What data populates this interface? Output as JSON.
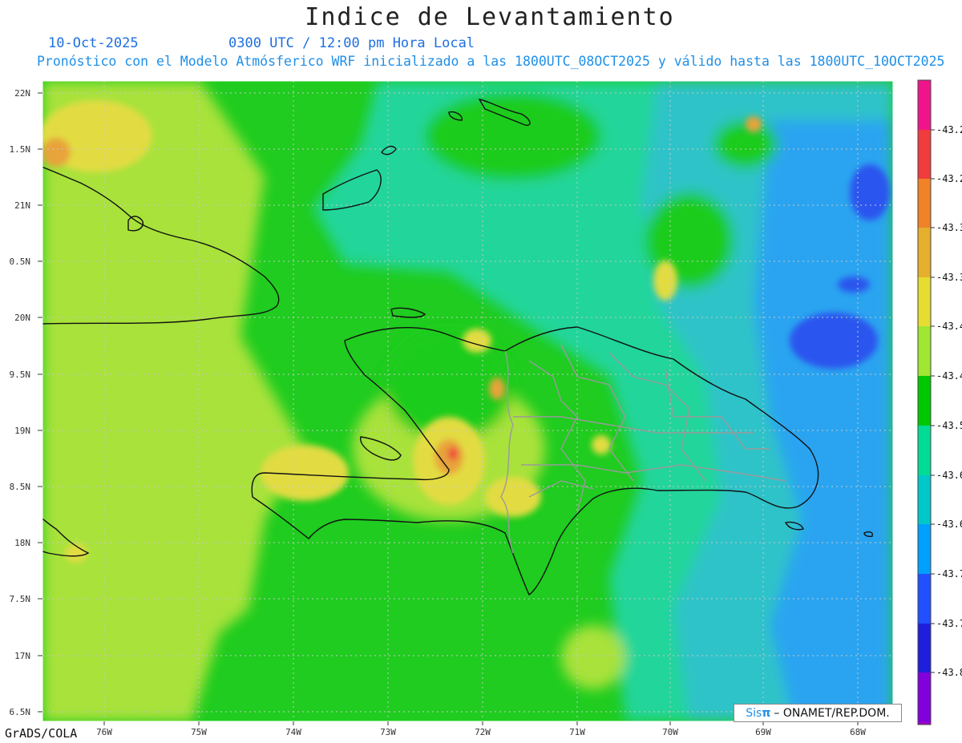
{
  "title": "Indice de Levantamiento",
  "date": "10-Oct-2025",
  "time": "0300 UTC / 12:00 pm Hora Local",
  "subtitle": "Pronóstico con el Modelo Atmósferico WRF inicializado a las 1800UTC_08OCT2025 y válido hasta las  1800UTC_10OCT2025",
  "credit": "GrADS/COLA",
  "signature": {
    "brand": "Sis",
    "symbol": "π",
    "rest": "– ONAMET/REP.DOM."
  },
  "lat_labels": [
    "22N",
    "1.5N",
    "21N",
    "0.5N",
    "20N",
    "9.5N",
    "19N",
    "8.5N",
    "18N",
    "7.5N",
    "17N",
    "6.5N"
  ],
  "lon_labels": [
    "76W",
    "75W",
    "74W",
    "73W",
    "72W",
    "71W",
    "70W",
    "69W",
    "68W"
  ],
  "colorbar": {
    "labels": [
      "-43.2",
      "-43.2",
      "-43.3",
      "-43.3",
      "-43.4",
      "-43.4",
      "-43.5",
      "-43.6",
      "-43.6",
      "-43.7",
      "-43.7",
      "-43.8"
    ],
    "colors": [
      "#f0148c",
      "#f03c3c",
      "#f08228",
      "#e6af2d",
      "#e6dc32",
      "#a0e632",
      "#00c800",
      "#00dc96",
      "#00c8c8",
      "#00a0ff",
      "#2050ff",
      "#1e1edc",
      "#8200dc",
      "#a000c8"
    ]
  },
  "field_colors": {
    "green": "#1fcc1f",
    "light_green": "#a8e23a",
    "yellow": "#e2dc42",
    "orange": "#e8a33a",
    "teal": "#22d59a",
    "cyan": "#2fc3c8",
    "light_blue": "#2aa4f0",
    "blue": "#2a55ee",
    "red": "#f03c3c",
    "pink": "#f0148c"
  }
}
